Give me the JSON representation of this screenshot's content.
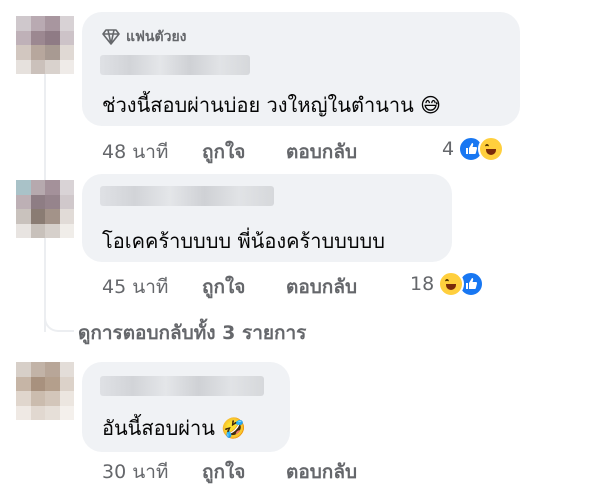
{
  "comments": [
    {
      "badge": "แฟนตัวยง",
      "text": "ช่วงนี้สอบผ่านบ่อย วงใหญ่ในตำนาน",
      "emoji": "😅",
      "time": "48 นาที",
      "like_label": "ถูกใจ",
      "reply_label": "ตอบกลับ",
      "reaction_count": "4",
      "reactions": [
        "like-reaction-icon",
        "haha-reaction-icon"
      ]
    },
    {
      "text": "โอเคคร้าบบบบ พี่น้องคร้าบบบบบ",
      "time": "45 นาที",
      "like_label": "ถูกใจ",
      "reply_label": "ตอบกลับ",
      "reaction_count": "18",
      "reactions": [
        "haha-reaction-icon",
        "like-reaction-icon"
      ]
    },
    {
      "text": "อันนี้สอบผ่าน",
      "emoji": "🤣",
      "time": "30 นาที",
      "like_label": "ถูกใจ",
      "reply_label": "ตอบกลับ"
    }
  ],
  "view_replies": "ดูการตอบกลับทั้ง 3 รายการ",
  "colors": {
    "bubble": "#f0f2f5",
    "meta_text": "#65676b",
    "like_blue": "#1877f2",
    "haha_yellow": "#ffcf3d"
  }
}
